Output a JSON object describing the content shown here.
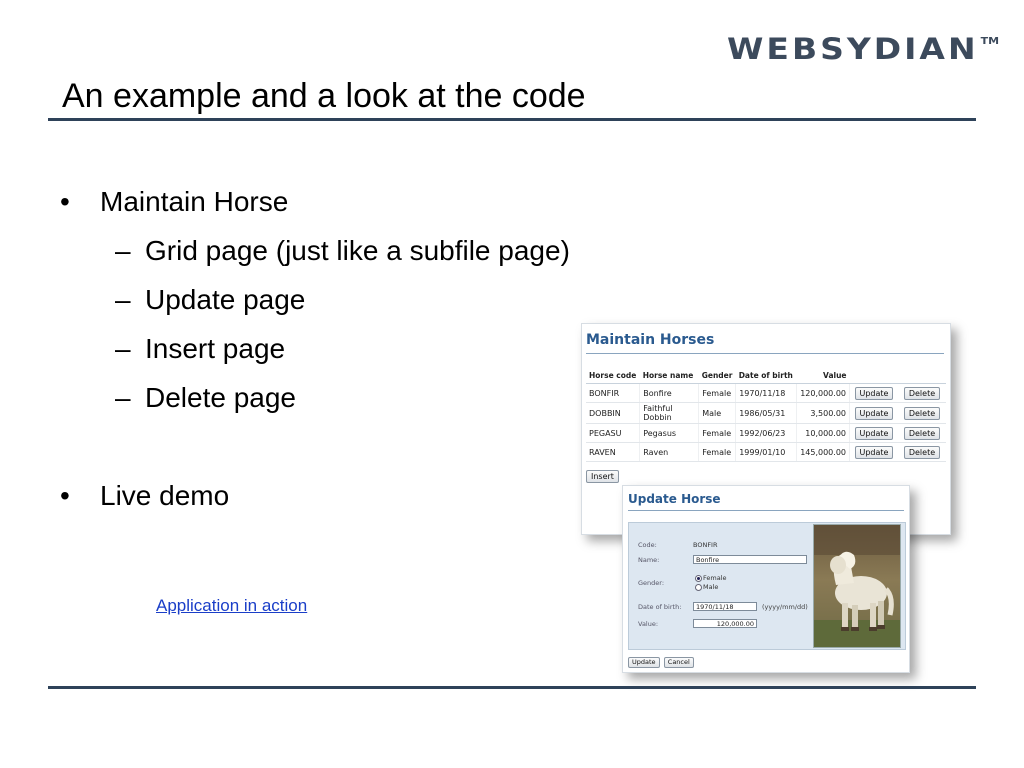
{
  "logo": {
    "text": "WEBSYDIAN",
    "tm": "TM"
  },
  "slide": {
    "title": "An example and a look at the code",
    "bullets": [
      {
        "level": 1,
        "text": "Maintain Horse"
      },
      {
        "level": 2,
        "text": "Grid page (just like a subfile page)"
      },
      {
        "level": 2,
        "text": "Update page"
      },
      {
        "level": 2,
        "text": "Insert page"
      },
      {
        "level": 2,
        "text": "Delete page"
      },
      {
        "level": 1,
        "text": "Live demo"
      }
    ],
    "link_text": "Application in action"
  },
  "grid_shot": {
    "title": "Maintain Horses",
    "headers": [
      "Horse code",
      "Horse name",
      "Gender",
      "Date of birth",
      "Value"
    ],
    "rows": [
      {
        "code": "BONFIR",
        "name": "Bonfire",
        "gender": "Female",
        "dob": "1970/11/18",
        "value": "120,000.00"
      },
      {
        "code": "DOBBIN",
        "name": "Faithful Dobbin",
        "gender": "Male",
        "dob": "1986/05/31",
        "value": "3,500.00"
      },
      {
        "code": "PEGASU",
        "name": "Pegasus",
        "gender": "Female",
        "dob": "1992/06/23",
        "value": "10,000.00"
      },
      {
        "code": "RAVEN",
        "name": "Raven",
        "gender": "Female",
        "dob": "1999/01/10",
        "value": "145,000.00"
      }
    ],
    "update_label": "Update",
    "delete_label": "Delete",
    "insert_label": "Insert"
  },
  "update_shot": {
    "title": "Update Horse",
    "code_label": "Code:",
    "code_value": "BONFIR",
    "name_label": "Name:",
    "name_value": "Bonfire",
    "gender_label": "Gender:",
    "gender_options": [
      "Female",
      "Male"
    ],
    "gender_selected": "Female",
    "dob_label": "Date of birth:",
    "dob_value": "1970/11/18",
    "dob_format": "(yyyy/mm/dd)",
    "value_label": "Value:",
    "value_value": "120,000.00",
    "update_label": "Update",
    "cancel_label": "Cancel"
  },
  "colors": {
    "rule": "#2e4259",
    "logo": "#3c4a5c",
    "app_title": "#2a5a8f",
    "link": "#1a3ec8",
    "panel": "#dde7f1"
  }
}
